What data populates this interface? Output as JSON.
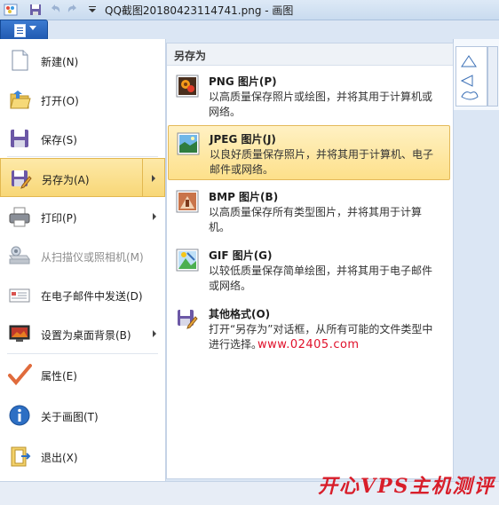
{
  "window": {
    "title": "QQ截图20180423114741.png - 画图"
  },
  "left_menu": {
    "items": [
      {
        "label": "新建(N)",
        "icon": "new-doc-icon"
      },
      {
        "label": "打开(O)",
        "icon": "open-folder-icon"
      },
      {
        "label": "保存(S)",
        "icon": "save-floppy-icon"
      },
      {
        "label": "另存为(A)",
        "icon": "save-as-icon"
      },
      {
        "label": "打印(P)",
        "icon": "printer-icon"
      },
      {
        "label": "从扫描仪或照相机(M)",
        "icon": "scanner-icon"
      },
      {
        "label": "在电子邮件中发送(D)",
        "icon": "email-icon"
      },
      {
        "label": "设置为桌面背景(B)",
        "icon": "desktop-icon"
      },
      {
        "label": "属性(E)",
        "icon": "checkmark-icon"
      },
      {
        "label": "关于画图(T)",
        "icon": "info-icon"
      },
      {
        "label": "退出(X)",
        "icon": "exit-icon"
      }
    ]
  },
  "save_as_pane": {
    "header": "另存为",
    "items": [
      {
        "title": "PNG 图片(P)",
        "desc": "以高质量保存照片或绘图，并将其用于计算机或网络。",
        "icon": "png-image-icon"
      },
      {
        "title": "JPEG 图片(J)",
        "desc": "以良好质量保存照片，并将其用于计算机、电子邮件或网络。",
        "icon": "jpeg-image-icon"
      },
      {
        "title": "BMP 图片(B)",
        "desc": "以高质量保存所有类型图片，并将其用于计算机。",
        "icon": "bmp-image-icon"
      },
      {
        "title": "GIF 图片(G)",
        "desc": "以较低质量保存简单绘图，并将其用于电子邮件或网络。",
        "icon": "gif-image-icon"
      },
      {
        "title": "其他格式(O)",
        "desc": "打开“另存为”对话框，从所有可能的文件类型中进行选择。",
        "icon": "other-format-icon"
      }
    ]
  },
  "watermark": {
    "url": "www.02405.com",
    "brand": "开心VPS主机测评"
  },
  "colors": {
    "highlight": "#fde08a",
    "accent": "#1f58b0",
    "watermark": "#d81e2a"
  }
}
